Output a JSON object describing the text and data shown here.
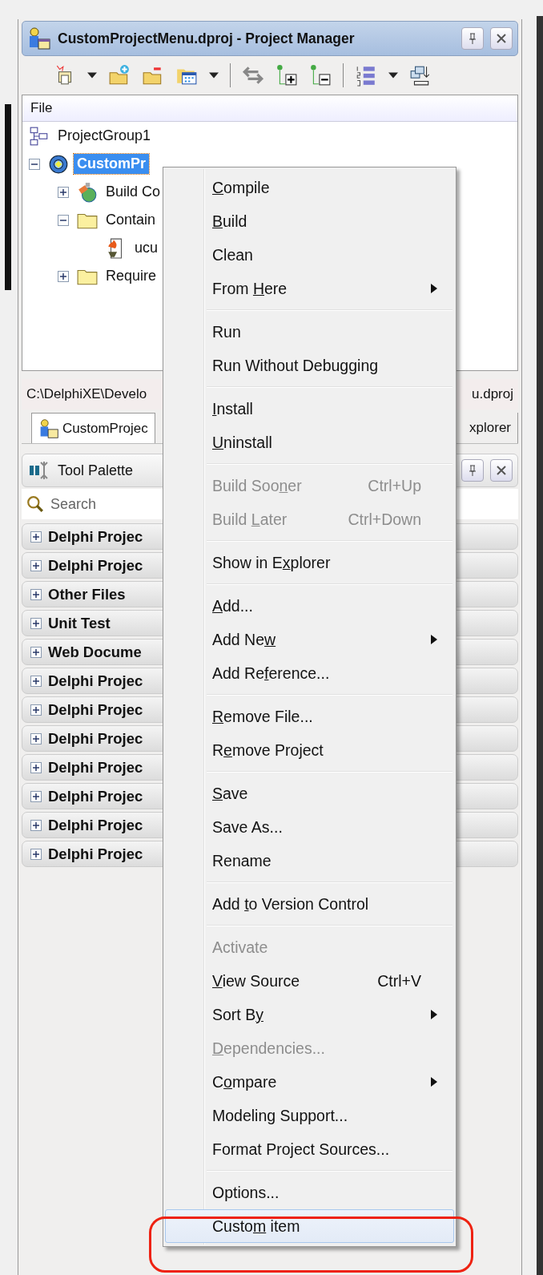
{
  "panel": {
    "title": "CustomProjectMenu.dproj - Project Manager"
  },
  "tree": {
    "header": "File",
    "nodes": [
      {
        "kind": "group",
        "label": "ProjectGroup1",
        "selected": false,
        "children": [
          {
            "kind": "project",
            "label": "CustomPr",
            "expanded": true,
            "selected": true,
            "children": [
              {
                "kind": "build",
                "label": "Build Co",
                "expanded": false,
                "selected": false
              },
              {
                "kind": "folder",
                "label": "Contain",
                "expanded": true,
                "selected": false,
                "children": [
                  {
                    "kind": "file",
                    "label": "ucu",
                    "selected": false
                  }
                ]
              },
              {
                "kind": "folder",
                "label": "Require",
                "expanded": false,
                "selected": false
              }
            ]
          }
        ]
      }
    ]
  },
  "path_bar": {
    "left": "C:\\DelphiXE\\Develo",
    "right": "u.dproj"
  },
  "tabs": [
    {
      "label": "CustomProjec",
      "selected": true
    },
    {
      "label": "xplorer",
      "selected": false
    }
  ],
  "tool_palette": {
    "title": "Tool Palette",
    "search": {
      "placeholder": "Search"
    },
    "categories": [
      "Delphi Projec",
      "Delphi Projec",
      "Other Files",
      "Unit Test",
      "Web Docume",
      "Delphi Projec",
      "Delphi Projec",
      "Delphi Projec",
      "Delphi Projec",
      "Delphi Projec",
      "Delphi Projec",
      "Delphi Projec"
    ]
  },
  "context_menu": [
    {
      "kind": "item",
      "key": "C",
      "post": "ompile",
      "disabled": false,
      "submenu": false,
      "selected": false
    },
    {
      "kind": "item",
      "key": "B",
      "post": "uild",
      "disabled": false,
      "submenu": false,
      "selected": false
    },
    {
      "kind": "item",
      "pre": "Clean",
      "disabled": false,
      "submenu": false,
      "selected": false
    },
    {
      "kind": "item",
      "pre": "From ",
      "key": "H",
      "post": "ere",
      "disabled": false,
      "submenu": true,
      "selected": false
    },
    {
      "kind": "separator"
    },
    {
      "kind": "item",
      "pre": "Run",
      "disabled": false,
      "submenu": false,
      "selected": false
    },
    {
      "kind": "item",
      "pre": "Run Without Debu",
      "key": "g",
      "post": "ging",
      "disabled": false,
      "submenu": false,
      "selected": false
    },
    {
      "kind": "separator"
    },
    {
      "kind": "item",
      "key": "I",
      "post": "nstall",
      "disabled": false,
      "submenu": false,
      "selected": false
    },
    {
      "kind": "item",
      "key": "U",
      "post": "ninstall",
      "disabled": false,
      "submenu": false,
      "selected": false
    },
    {
      "kind": "separator"
    },
    {
      "kind": "item",
      "pre": "Build Soo",
      "key": "n",
      "post": "er",
      "shortcut": "Ctrl+Up",
      "disabled": true,
      "submenu": false,
      "selected": false
    },
    {
      "kind": "item",
      "pre": "Build ",
      "key": "L",
      "post": "ater",
      "shortcut": "Ctrl+Down",
      "disabled": true,
      "submenu": false,
      "selected": false
    },
    {
      "kind": "separator"
    },
    {
      "kind": "item",
      "pre": "Show in E",
      "key": "x",
      "post": "plorer",
      "disabled": false,
      "submenu": false,
      "selected": false
    },
    {
      "kind": "separator"
    },
    {
      "kind": "item",
      "key": "A",
      "post": "dd...",
      "disabled": false,
      "submenu": false,
      "selected": false
    },
    {
      "kind": "item",
      "pre": "Add Ne",
      "key": "w",
      "disabled": false,
      "submenu": true,
      "selected": false
    },
    {
      "kind": "item",
      "pre": "Add Re",
      "key": "f",
      "post": "erence...",
      "disabled": false,
      "submenu": false,
      "selected": false
    },
    {
      "kind": "separator"
    },
    {
      "kind": "item",
      "key": "R",
      "post": "emove File...",
      "disabled": false,
      "submenu": false,
      "selected": false
    },
    {
      "kind": "item",
      "pre": "R",
      "key": "e",
      "post": "move Project",
      "disabled": false,
      "submenu": false,
      "selected": false
    },
    {
      "kind": "separator"
    },
    {
      "kind": "item",
      "key": "S",
      "post": "ave",
      "disabled": false,
      "submenu": false,
      "selected": false
    },
    {
      "kind": "item",
      "pre": "Save As...",
      "disabled": false,
      "submenu": false,
      "selected": false
    },
    {
      "kind": "item",
      "pre": "Rename",
      "disabled": false,
      "submenu": false,
      "selected": false
    },
    {
      "kind": "separator"
    },
    {
      "kind": "item",
      "pre": "Add ",
      "key": "t",
      "post": "o Version Control",
      "disabled": false,
      "submenu": false,
      "selected": false
    },
    {
      "kind": "separator"
    },
    {
      "kind": "item",
      "pre": "Activate",
      "disabled": true,
      "submenu": false,
      "selected": false
    },
    {
      "kind": "item",
      "key": "V",
      "post": "iew Source",
      "shortcut": "Ctrl+V",
      "disabled": false,
      "submenu": false,
      "selected": false
    },
    {
      "kind": "item",
      "pre": "Sort B",
      "key": "y",
      "disabled": false,
      "submenu": true,
      "selected": false
    },
    {
      "kind": "item",
      "key": "D",
      "post": "ependencies...",
      "disabled": true,
      "submenu": false,
      "selected": false
    },
    {
      "kind": "item",
      "pre": "C",
      "key": "o",
      "post": "mpare",
      "disabled": false,
      "submenu": true,
      "selected": false
    },
    {
      "kind": "item",
      "pre": "Modeling Support...",
      "disabled": false,
      "submenu": false,
      "selected": false
    },
    {
      "kind": "item",
      "pre": "Format Pro",
      "key": "j",
      "post": "ect Sources...",
      "disabled": false,
      "submenu": false,
      "selected": false
    },
    {
      "kind": "separator"
    },
    {
      "kind": "item",
      "pre": "Options...",
      "disabled": false,
      "submenu": false,
      "selected": false
    },
    {
      "kind": "item",
      "pre": "Custo",
      "key": "m",
      "post": " item",
      "disabled": false,
      "submenu": false,
      "selected": true
    }
  ]
}
